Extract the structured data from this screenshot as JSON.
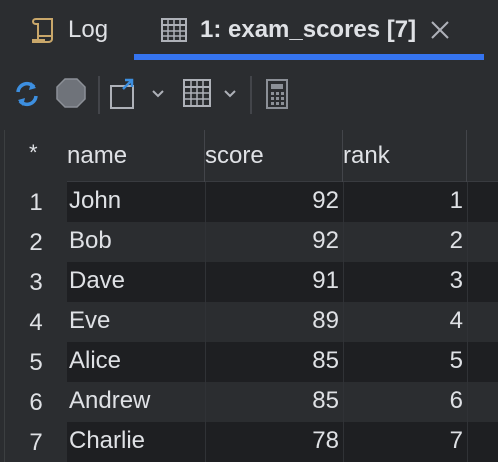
{
  "tabs": [
    {
      "label": "Log",
      "icon": "scroll-icon"
    },
    {
      "label": "1: exam_scores [7]",
      "icon": "table-icon",
      "active": true
    }
  ],
  "toolbar": {
    "items": [
      "refresh-icon",
      "stop-icon",
      "export-icon",
      "view-mode-icon",
      "calculator-icon"
    ]
  },
  "grid": {
    "corner": "*",
    "columns": [
      "name",
      "score",
      "rank"
    ],
    "rows": [
      {
        "num": "1",
        "name": "John",
        "score": "92",
        "rank": "1"
      },
      {
        "num": "2",
        "name": "Bob",
        "score": "92",
        "rank": "2"
      },
      {
        "num": "3",
        "name": "Dave",
        "score": "91",
        "rank": "3"
      },
      {
        "num": "4",
        "name": "Eve",
        "score": "89",
        "rank": "4"
      },
      {
        "num": "5",
        "name": "Alice",
        "score": "85",
        "rank": "5"
      },
      {
        "num": "6",
        "name": "Andrew",
        "score": "85",
        "rank": "6"
      },
      {
        "num": "7",
        "name": "Charlie",
        "score": "78",
        "rank": "7"
      }
    ]
  },
  "colors": {
    "accent": "#3574f0",
    "background": "#2b2d30",
    "grid_background": "#1e1f22",
    "text": "#dfe1e5"
  }
}
